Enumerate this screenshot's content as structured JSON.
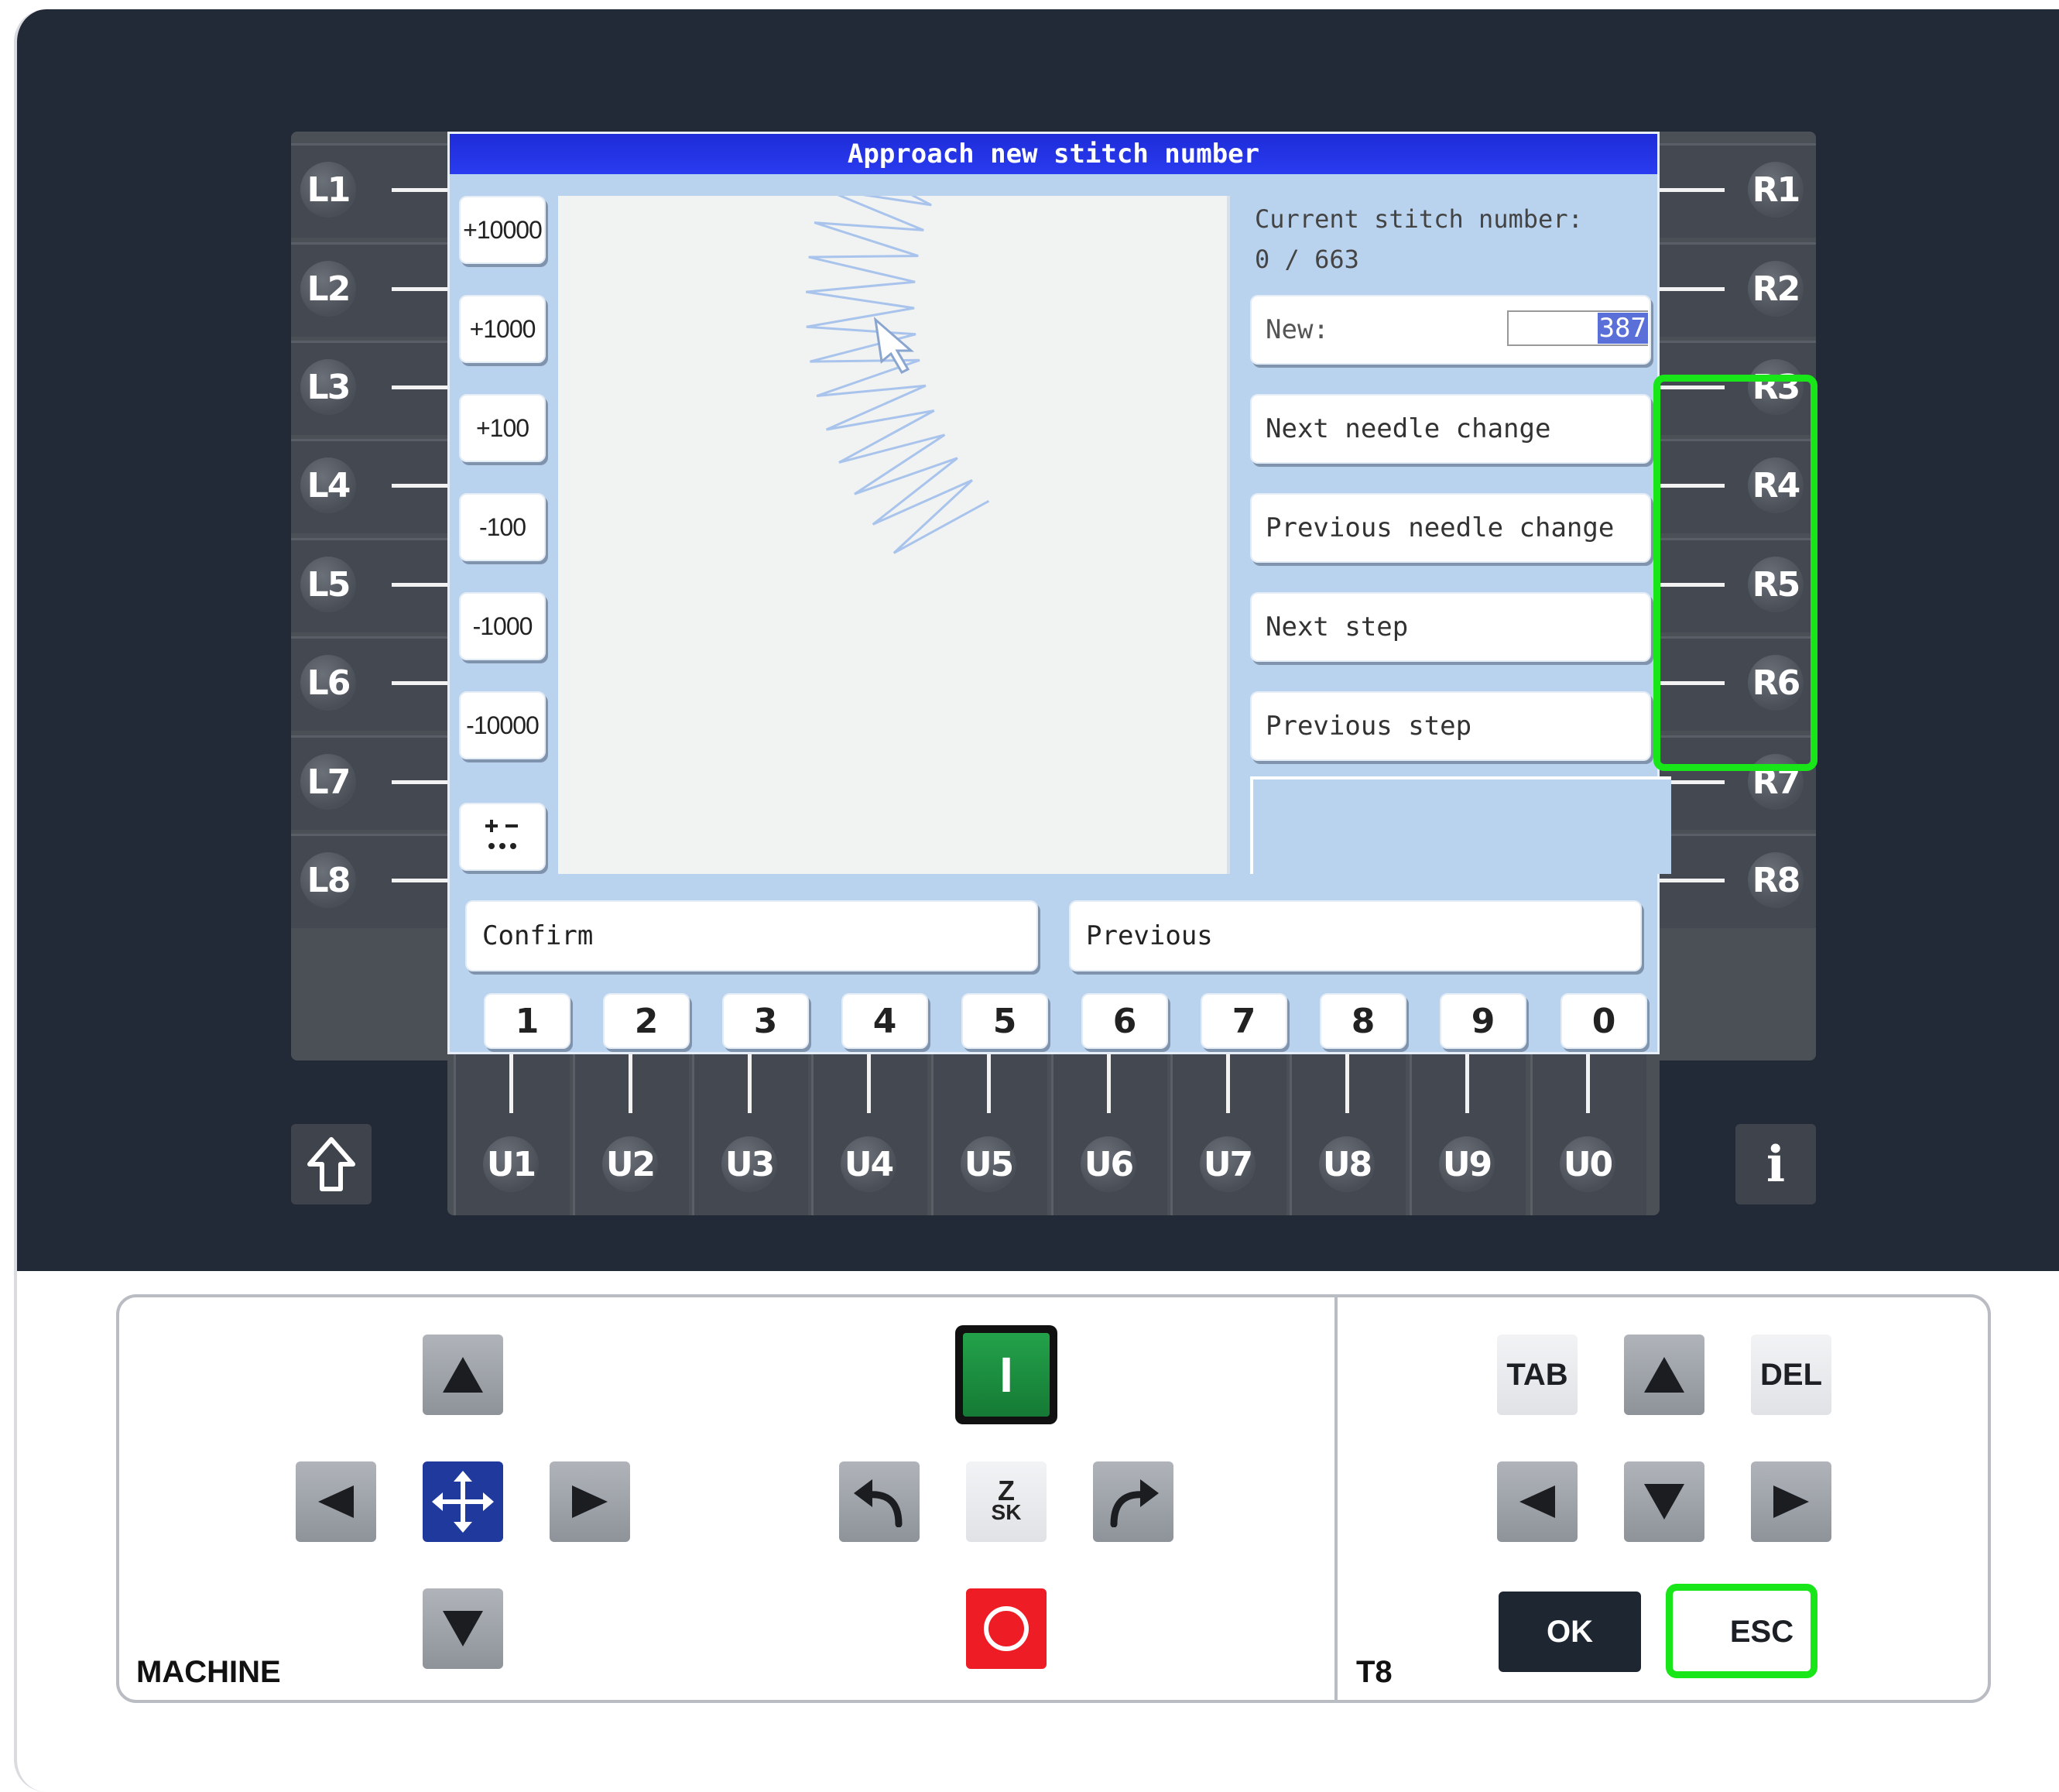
{
  "screen": {
    "title": "Approach new stitch number",
    "current_label": "Current stitch number:",
    "current_value": "0 / 663",
    "new_label": "New:",
    "new_value": "387",
    "step_buttons": [
      "+10000",
      "+1000",
      "+100",
      "-100",
      "-1000",
      "-10000"
    ],
    "sign_toggle_icon": "plus-minus-dots-icon",
    "right_buttons": [
      "Next needle change",
      "Previous needle change",
      "Next step",
      "Previous step"
    ],
    "confirm_label": "Confirm",
    "previous_label": "Previous",
    "digit_buttons": [
      "1",
      "2",
      "3",
      "4",
      "5",
      "6",
      "7",
      "8",
      "9",
      "0"
    ]
  },
  "softkeys": {
    "left": [
      "L1",
      "L2",
      "L3",
      "L4",
      "L5",
      "L6",
      "L7",
      "L8"
    ],
    "right": [
      "R1",
      "R2",
      "R3",
      "R4",
      "R5",
      "R6",
      "R7",
      "R8"
    ],
    "bottom": [
      "U1",
      "U2",
      "U3",
      "U4",
      "U5",
      "U6",
      "U7",
      "U8",
      "U9",
      "U0"
    ],
    "shift_icon": "shift-arrow-icon",
    "info_label": "i"
  },
  "keyboard": {
    "machine_label": "MACHINE",
    "t8_label": "T8",
    "tab_label": "TAB",
    "del_label": "DEL",
    "ok_label": "OK",
    "esc_label": "ESC",
    "start_label": "I",
    "logo_text_top": "Z",
    "logo_text_bottom": "SK"
  },
  "colors": {
    "panel": "#232a37",
    "screen_bg": "#b9d3ef",
    "title_bar": "#2233e0",
    "highlight": "#19e619",
    "start_green": "#1a8a3a",
    "stop_red": "#ee1c24",
    "move_blue": "#1f3a9c",
    "stitch_line": "#a9c4ec"
  }
}
